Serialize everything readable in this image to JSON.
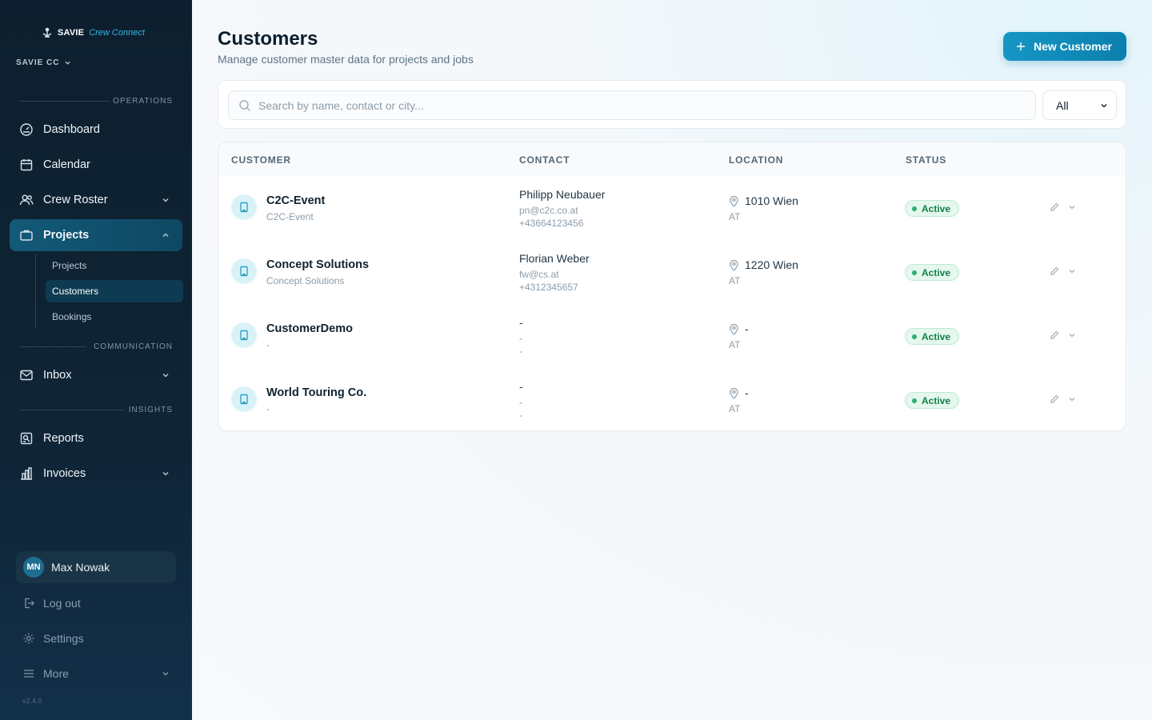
{
  "brand": {
    "strong": "SAVIE",
    "light": "Crew Connect"
  },
  "org": {
    "label": "SAVIE CC"
  },
  "sidebar": {
    "sections": {
      "operations": "OPERATIONS",
      "communication": "COMMUNICATION",
      "insights": "INSIGHTS"
    },
    "items": {
      "dashboard": "Dashboard",
      "calendar": "Calendar",
      "crew_roster": "Crew Roster",
      "projects": "Projects",
      "inbox": "Inbox",
      "reports": "Reports",
      "invoices": "Invoices"
    },
    "projects_sub": [
      "Projects",
      "Customers",
      "Bookings"
    ],
    "user": {
      "initials": "MN",
      "name": "Max Nowak"
    },
    "logout": "Log out",
    "settings": "Settings",
    "more": "More",
    "version": "v2.4.0"
  },
  "header": {
    "title": "Customers",
    "subtitle": "Manage customer master data for projects and jobs",
    "new_button": "New Customer"
  },
  "filters": {
    "search_placeholder": "Search by name, contact or city...",
    "status_value": "All"
  },
  "table": {
    "columns": [
      "CUSTOMER",
      "CONTACT",
      "LOCATION",
      "STATUS"
    ],
    "rows": [
      {
        "name": "C2C-Event",
        "sub": "C2C-Event",
        "contact": "Philipp Neubauer",
        "email": "pn@c2c.co.at",
        "phone": "+43664123456",
        "city": "1010 Wien",
        "country": "AT",
        "status": "Active"
      },
      {
        "name": "Concept Solutions",
        "sub": "Concept Solutions",
        "contact": "Florian Weber",
        "email": "fw@cs.at",
        "phone": "+4312345657",
        "city": "1220 Wien",
        "country": "AT",
        "status": "Active"
      },
      {
        "name": "CustomerDemo",
        "sub": "-",
        "contact": "-",
        "email": "-",
        "phone": "-",
        "city": "-",
        "country": "AT",
        "status": "Active"
      },
      {
        "name": "World Touring Co.",
        "sub": "-",
        "contact": "-",
        "email": "-",
        "phone": "-",
        "city": "-",
        "country": "AT",
        "status": "Active"
      }
    ]
  },
  "colors": {
    "accent": "#0b7fae",
    "sidebar_bg": "#0d1f2e",
    "active_badge": "#12804a"
  }
}
